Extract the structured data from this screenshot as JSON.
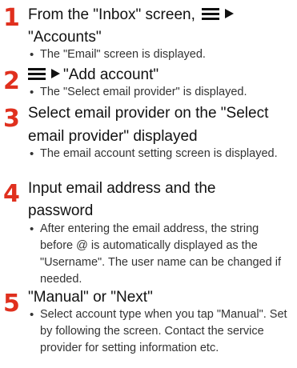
{
  "steps": [
    {
      "number": "1",
      "title_line1": "From the \"Inbox\" screen,",
      "title_line2": "\"Accounts\"",
      "bullets": [
        "The \"Email\" screen is displayed."
      ]
    },
    {
      "number": "2",
      "title_text": "\"Add account\"",
      "bullets": [
        "The \"Select email provider\" is displayed."
      ]
    },
    {
      "number": "3",
      "title_line1": "Select email provider on the \"Select",
      "title_line2": "email provider\" displayed",
      "bullets": [
        "The email account setting screen is displayed."
      ]
    },
    {
      "number": "4",
      "title_line1": "Input email address and the",
      "title_line2": "password",
      "bullets": [
        "After entering the email address, the string before @ is automatically displayed as the \"Username\". The user name can be changed if needed."
      ]
    },
    {
      "number": "5",
      "title_text": "\"Manual\" or \"Next\"",
      "bullets": [
        "Select account type when you tap \"Manual\". Set by following the screen. Contact the service provider for setting information etc."
      ]
    }
  ],
  "icons": {
    "menu": "menu-icon",
    "arrow": "arrow-right-icon"
  },
  "colors": {
    "step_number": "#e0301e",
    "text": "#111111",
    "bullet_text": "#333333"
  }
}
